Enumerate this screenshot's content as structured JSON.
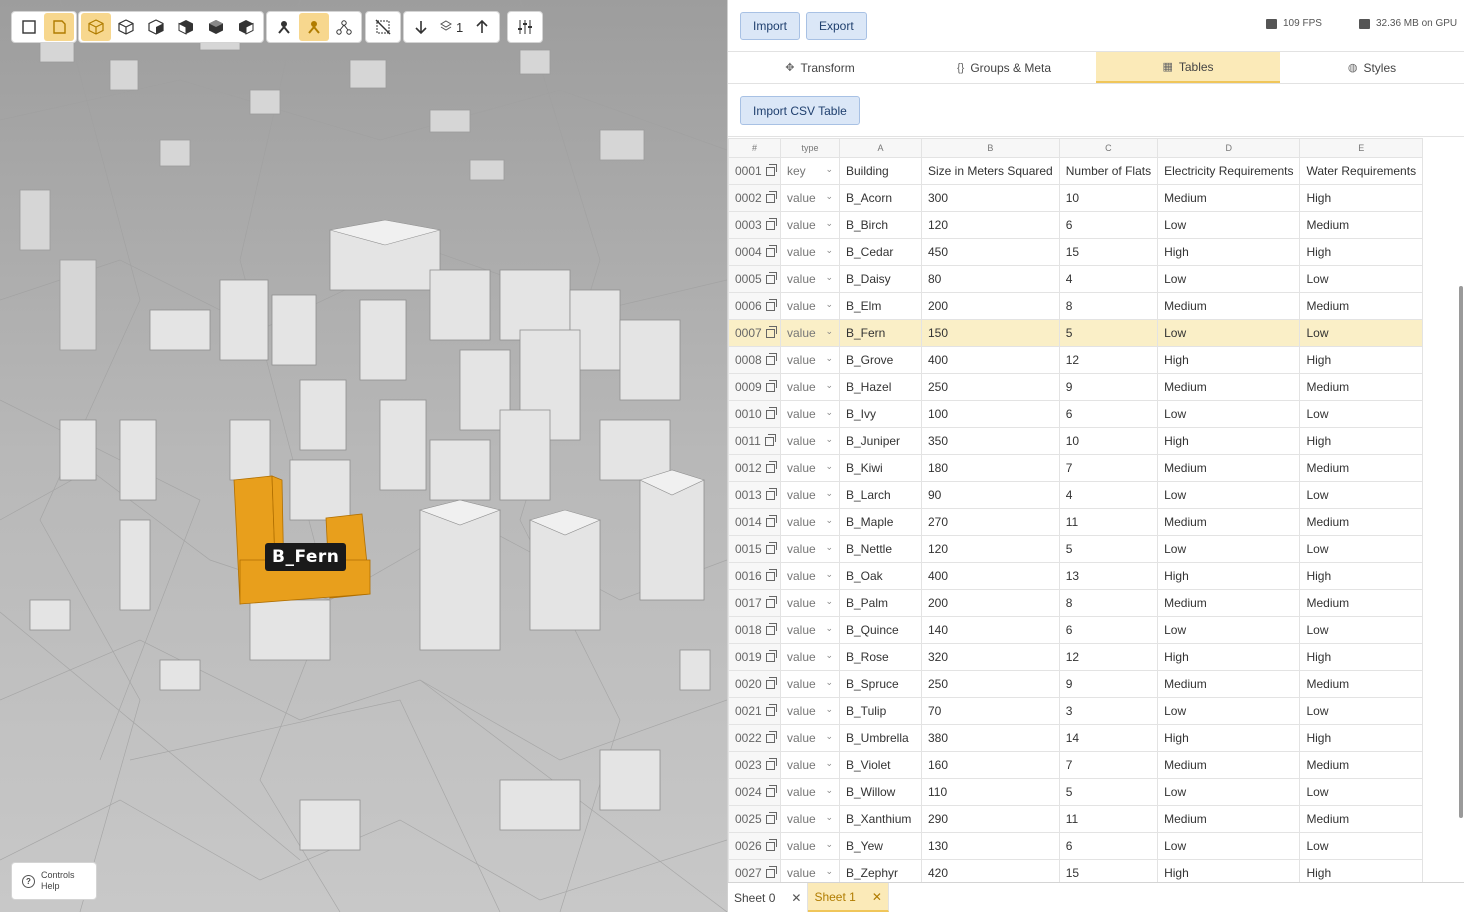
{
  "toolbar": {
    "level": "1"
  },
  "viewport": {
    "selected_label": "B_Fern",
    "controls_help": "Controls Help",
    "controls_help_line1": "Controls",
    "controls_help_line2": "Help"
  },
  "topbar": {
    "import": "Import",
    "export": "Export",
    "fps": "109 FPS",
    "gpu": "32.36 MB on GPU"
  },
  "tabs": [
    {
      "label": "Transform",
      "icon": "move-icon"
    },
    {
      "label": "Groups & Meta",
      "icon": "braces-icon"
    },
    {
      "label": "Tables",
      "icon": "table-icon",
      "active": true
    },
    {
      "label": "Styles",
      "icon": "palette-icon"
    }
  ],
  "import_csv": "Import CSV Table",
  "grid": {
    "col_letters": [
      "#",
      "type",
      "A",
      "B",
      "C",
      "D",
      "E"
    ],
    "rows": [
      {
        "n": "0001",
        "type": "key",
        "a": "Building",
        "b": "Size in Meters Squared",
        "c": "Number of Flats",
        "d": "Electricity Requirements",
        "e": "Water Requirements"
      },
      {
        "n": "0002",
        "type": "value",
        "a": "B_Acorn",
        "b": "300",
        "c": "10",
        "d": "Medium",
        "e": "High"
      },
      {
        "n": "0003",
        "type": "value",
        "a": "B_Birch",
        "b": "120",
        "c": "6",
        "d": "Low",
        "e": "Medium"
      },
      {
        "n": "0004",
        "type": "value",
        "a": "B_Cedar",
        "b": "450",
        "c": "15",
        "d": "High",
        "e": "High"
      },
      {
        "n": "0005",
        "type": "value",
        "a": "B_Daisy",
        "b": "80",
        "c": "4",
        "d": "Low",
        "e": "Low"
      },
      {
        "n": "0006",
        "type": "value",
        "a": "B_Elm",
        "b": "200",
        "c": "8",
        "d": "Medium",
        "e": "Medium"
      },
      {
        "n": "0007",
        "type": "value",
        "a": "B_Fern",
        "b": "150",
        "c": "5",
        "d": "Low",
        "e": "Low",
        "selected": true
      },
      {
        "n": "0008",
        "type": "value",
        "a": "B_Grove",
        "b": "400",
        "c": "12",
        "d": "High",
        "e": "High"
      },
      {
        "n": "0009",
        "type": "value",
        "a": "B_Hazel",
        "b": "250",
        "c": "9",
        "d": "Medium",
        "e": "Medium"
      },
      {
        "n": "0010",
        "type": "value",
        "a": "B_Ivy",
        "b": "100",
        "c": "6",
        "d": "Low",
        "e": "Low"
      },
      {
        "n": "0011",
        "type": "value",
        "a": "B_Juniper",
        "b": "350",
        "c": "10",
        "d": "High",
        "e": "High"
      },
      {
        "n": "0012",
        "type": "value",
        "a": "B_Kiwi",
        "b": "180",
        "c": "7",
        "d": "Medium",
        "e": "Medium"
      },
      {
        "n": "0013",
        "type": "value",
        "a": "B_Larch",
        "b": "90",
        "c": "4",
        "d": "Low",
        "e": "Low"
      },
      {
        "n": "0014",
        "type": "value",
        "a": "B_Maple",
        "b": "270",
        "c": "11",
        "d": "Medium",
        "e": "Medium"
      },
      {
        "n": "0015",
        "type": "value",
        "a": "B_Nettle",
        "b": "120",
        "c": "5",
        "d": "Low",
        "e": "Low"
      },
      {
        "n": "0016",
        "type": "value",
        "a": "B_Oak",
        "b": "400",
        "c": "13",
        "d": "High",
        "e": "High"
      },
      {
        "n": "0017",
        "type": "value",
        "a": "B_Palm",
        "b": "200",
        "c": "8",
        "d": "Medium",
        "e": "Medium"
      },
      {
        "n": "0018",
        "type": "value",
        "a": "B_Quince",
        "b": "140",
        "c": "6",
        "d": "Low",
        "e": "Low"
      },
      {
        "n": "0019",
        "type": "value",
        "a": "B_Rose",
        "b": "320",
        "c": "12",
        "d": "High",
        "e": "High"
      },
      {
        "n": "0020",
        "type": "value",
        "a": "B_Spruce",
        "b": "250",
        "c": "9",
        "d": "Medium",
        "e": "Medium"
      },
      {
        "n": "0021",
        "type": "value",
        "a": "B_Tulip",
        "b": "70",
        "c": "3",
        "d": "Low",
        "e": "Low"
      },
      {
        "n": "0022",
        "type": "value",
        "a": "B_Umbrella",
        "b": "380",
        "c": "14",
        "d": "High",
        "e": "High"
      },
      {
        "n": "0023",
        "type": "value",
        "a": "B_Violet",
        "b": "160",
        "c": "7",
        "d": "Medium",
        "e": "Medium"
      },
      {
        "n": "0024",
        "type": "value",
        "a": "B_Willow",
        "b": "110",
        "c": "5",
        "d": "Low",
        "e": "Low"
      },
      {
        "n": "0025",
        "type": "value",
        "a": "B_Xanthium",
        "b": "290",
        "c": "11",
        "d": "Medium",
        "e": "Medium"
      },
      {
        "n": "0026",
        "type": "value",
        "a": "B_Yew",
        "b": "130",
        "c": "6",
        "d": "Low",
        "e": "Low"
      },
      {
        "n": "0027",
        "type": "value",
        "a": "B_Zephyr",
        "b": "420",
        "c": "15",
        "d": "High",
        "e": "High"
      }
    ]
  },
  "sheets": [
    {
      "label": "Sheet 0",
      "active": false
    },
    {
      "label": "Sheet 1",
      "active": true
    }
  ],
  "colors": {
    "accent": "#f0c65a",
    "highlight": "#e89f1c",
    "button_blue": "#dbe7f7"
  }
}
